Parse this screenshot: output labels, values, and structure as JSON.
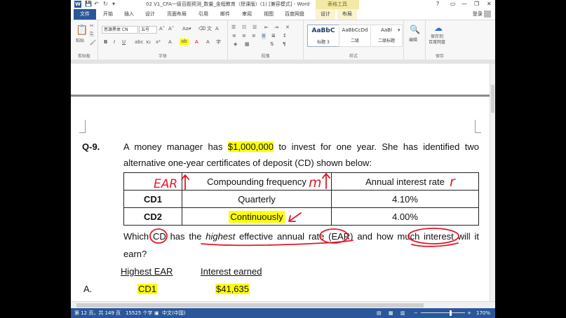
{
  "titlebar": {
    "title": "02 V1_CFA一级百题预测_数量_金程教育（授课版）(1) [兼容模式] - Word",
    "context_tab": "表格工具",
    "help": "?",
    "min": "—",
    "restore": "❐",
    "close": "✕"
  },
  "tabs": [
    "文件",
    "开始",
    "插入",
    "设计",
    "页面布局",
    "引用",
    "邮件",
    "审阅",
    "视图",
    "百度网盘",
    "设计",
    "布局"
  ],
  "login": "登录",
  "ribbon": {
    "paste": "粘贴",
    "clipboard": "剪贴板",
    "font_name": "思源黑体 CN",
    "font_size": "五号",
    "font_group": "字体",
    "para_group": "段落",
    "styles": [
      {
        "preview": "AaBbC",
        "name": "标题 3"
      },
      {
        "preview": "AaBbCcDd",
        "name": "二级"
      },
      {
        "preview": "AaBl",
        "name": "二级标题"
      }
    ],
    "styles_group": "样式",
    "edit": "编辑",
    "save_baidu": "保存到\n百度网盘",
    "save_group": "保存"
  },
  "question": {
    "number": "Q-9.",
    "line1_pre": "A money manager has ",
    "amount": "$1,000,000",
    "line1_post": " to invest for one year. She has identified two",
    "line2": "alternative one-year certificates of deposit (CD) shown below:",
    "table": {
      "headers": [
        "",
        "Compounding frequency",
        "Annual interest rate"
      ],
      "rows": [
        [
          "CD1",
          "Quarterly",
          "4.10%"
        ],
        [
          "CD2",
          "Continuously",
          "4.00%"
        ]
      ]
    },
    "ask_line1": [
      "Which ",
      "CD",
      " has the ",
      "highest",
      " effective annual rate (EAR) and how much interest will it"
    ],
    "ask_line2": "earn?",
    "col_heads": [
      "Highest EAR",
      "Interest earned"
    ],
    "option_label": "A.",
    "option_a": [
      "CD1",
      "$41,635"
    ]
  },
  "annotations": {
    "ear_label": "EAR",
    "m_label": "m",
    "r_label": "r",
    "ink_color": "#e0192a"
  },
  "status": {
    "page": "第 12 页，共 149 页",
    "words": "15525 个字",
    "lang": "中文(中国)",
    "zoom": "170%"
  }
}
